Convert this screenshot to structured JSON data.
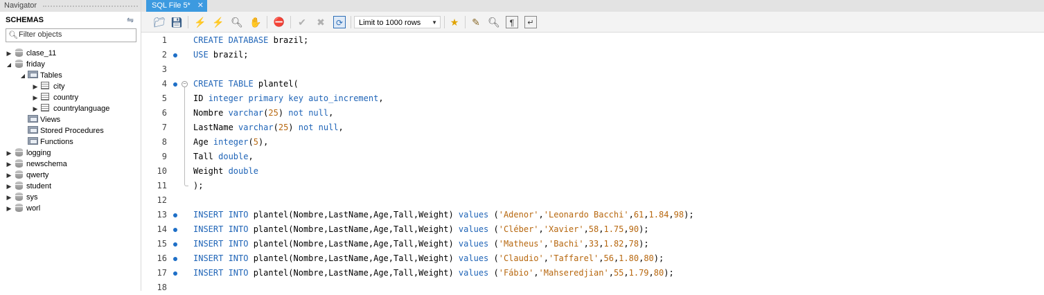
{
  "navigator": {
    "title": "Navigator",
    "schemas_label": "SCHEMAS",
    "filter_placeholder": "Filter objects",
    "tree": [
      {
        "label": "clase_11",
        "level": 0,
        "kind": "db",
        "expanded": false
      },
      {
        "label": "friday",
        "level": 0,
        "kind": "db",
        "expanded": true
      },
      {
        "label": "Tables",
        "level": 1,
        "kind": "folder",
        "expanded": true
      },
      {
        "label": "city",
        "level": 2,
        "kind": "table",
        "expanded": false
      },
      {
        "label": "country",
        "level": 2,
        "kind": "table",
        "expanded": false
      },
      {
        "label": "countrylanguage",
        "level": 2,
        "kind": "table",
        "expanded": false
      },
      {
        "label": "Views",
        "level": 1,
        "kind": "folder",
        "expanded": null
      },
      {
        "label": "Stored Procedures",
        "level": 1,
        "kind": "folder",
        "expanded": null
      },
      {
        "label": "Functions",
        "level": 1,
        "kind": "folder",
        "expanded": null
      },
      {
        "label": "logging",
        "level": 0,
        "kind": "db",
        "expanded": false
      },
      {
        "label": "newschema",
        "level": 0,
        "kind": "db",
        "expanded": false
      },
      {
        "label": "qwerty",
        "level": 0,
        "kind": "db",
        "expanded": false
      },
      {
        "label": "student",
        "level": 0,
        "kind": "db",
        "expanded": false
      },
      {
        "label": "sys",
        "level": 0,
        "kind": "db",
        "expanded": false
      },
      {
        "label": "worl",
        "level": 0,
        "kind": "db",
        "expanded": false
      }
    ]
  },
  "editor_tab": {
    "label": "SQL File 5*",
    "close": "✕"
  },
  "toolbar": {
    "limit_select": "Limit to 1000 rows",
    "icons": [
      "open-file-icon",
      "save-icon",
      "execute-icon",
      "execute-current-icon",
      "explain-icon",
      "stop-icon",
      "toggle-error-icon",
      "commit-icon",
      "rollback-icon",
      "autocommit-icon",
      "add-snippet-icon",
      "beautify-icon",
      "find-icon",
      "invisible-chars-icon",
      "wrap-icon"
    ]
  },
  "editor": {
    "lines": [
      {
        "n": "1",
        "bullet": false,
        "tokens": [
          {
            "t": "CREATE DATABASE",
            "c": "kw"
          },
          {
            "t": " brazil;",
            "c": ""
          }
        ]
      },
      {
        "n": "2",
        "bullet": true,
        "tokens": [
          {
            "t": "USE",
            "c": "kw"
          },
          {
            "t": " brazil;",
            "c": ""
          }
        ]
      },
      {
        "n": "3",
        "bullet": false,
        "tokens": []
      },
      {
        "n": "4",
        "bullet": true,
        "fold": "start",
        "tokens": [
          {
            "t": "CREATE TABLE",
            "c": "kw"
          },
          {
            "t": " plantel(",
            "c": ""
          }
        ]
      },
      {
        "n": "5",
        "bullet": false,
        "tokens": [
          {
            "t": "ID ",
            "c": ""
          },
          {
            "t": "integer primary key auto_increment",
            "c": "kw"
          },
          {
            "t": ",",
            "c": ""
          }
        ]
      },
      {
        "n": "6",
        "bullet": false,
        "tokens": [
          {
            "t": "Nombre ",
            "c": ""
          },
          {
            "t": "varchar",
            "c": "kw"
          },
          {
            "t": "(",
            "c": ""
          },
          {
            "t": "25",
            "c": "num"
          },
          {
            "t": ") ",
            "c": ""
          },
          {
            "t": "not null",
            "c": "kw"
          },
          {
            "t": ",",
            "c": ""
          }
        ]
      },
      {
        "n": "7",
        "bullet": false,
        "tokens": [
          {
            "t": "LastName ",
            "c": ""
          },
          {
            "t": "varchar",
            "c": "kw"
          },
          {
            "t": "(",
            "c": ""
          },
          {
            "t": "25",
            "c": "num"
          },
          {
            "t": ") ",
            "c": ""
          },
          {
            "t": "not null",
            "c": "kw"
          },
          {
            "t": ",",
            "c": ""
          }
        ]
      },
      {
        "n": "8",
        "bullet": false,
        "tokens": [
          {
            "t": "Age ",
            "c": ""
          },
          {
            "t": "integer",
            "c": "kw"
          },
          {
            "t": "(",
            "c": ""
          },
          {
            "t": "5",
            "c": "num"
          },
          {
            "t": "),",
            "c": ""
          }
        ]
      },
      {
        "n": "9",
        "bullet": false,
        "tokens": [
          {
            "t": "Tall ",
            "c": ""
          },
          {
            "t": "double",
            "c": "kw"
          },
          {
            "t": ",",
            "c": ""
          }
        ]
      },
      {
        "n": "10",
        "bullet": false,
        "tokens": [
          {
            "t": "Weight ",
            "c": ""
          },
          {
            "t": "double",
            "c": "kw"
          }
        ]
      },
      {
        "n": "11",
        "bullet": false,
        "fold": "end",
        "tokens": [
          {
            "t": ");",
            "c": ""
          }
        ]
      },
      {
        "n": "12",
        "bullet": false,
        "tokens": []
      },
      {
        "n": "13",
        "bullet": true,
        "tokens": [
          {
            "t": "INSERT INTO",
            "c": "kw"
          },
          {
            "t": " plantel(Nombre,LastName,Age,Tall,Weight) ",
            "c": ""
          },
          {
            "t": "values",
            "c": "kw"
          },
          {
            "t": " (",
            "c": ""
          },
          {
            "t": "'Adenor'",
            "c": "str"
          },
          {
            "t": ",",
            "c": ""
          },
          {
            "t": "'Leonardo Bacchi'",
            "c": "str"
          },
          {
            "t": ",",
            "c": ""
          },
          {
            "t": "61",
            "c": "num"
          },
          {
            "t": ",",
            "c": ""
          },
          {
            "t": "1.84",
            "c": "num"
          },
          {
            "t": ",",
            "c": ""
          },
          {
            "t": "98",
            "c": "num"
          },
          {
            "t": ");",
            "c": ""
          }
        ]
      },
      {
        "n": "14",
        "bullet": true,
        "tokens": [
          {
            "t": "INSERT INTO",
            "c": "kw"
          },
          {
            "t": " plantel(Nombre,LastName,Age,Tall,Weight) ",
            "c": ""
          },
          {
            "t": "values",
            "c": "kw"
          },
          {
            "t": " (",
            "c": ""
          },
          {
            "t": "'Cléber'",
            "c": "str"
          },
          {
            "t": ",",
            "c": ""
          },
          {
            "t": "'Xavier'",
            "c": "str"
          },
          {
            "t": ",",
            "c": ""
          },
          {
            "t": "58",
            "c": "num"
          },
          {
            "t": ",",
            "c": ""
          },
          {
            "t": "1.75",
            "c": "num"
          },
          {
            "t": ",",
            "c": ""
          },
          {
            "t": "90",
            "c": "num"
          },
          {
            "t": ");",
            "c": ""
          }
        ]
      },
      {
        "n": "15",
        "bullet": true,
        "tokens": [
          {
            "t": "INSERT INTO",
            "c": "kw"
          },
          {
            "t": " plantel(Nombre,LastName,Age,Tall,Weight) ",
            "c": ""
          },
          {
            "t": "values",
            "c": "kw"
          },
          {
            "t": " (",
            "c": ""
          },
          {
            "t": "'Matheus'",
            "c": "str"
          },
          {
            "t": ",",
            "c": ""
          },
          {
            "t": "'Bachi'",
            "c": "str"
          },
          {
            "t": ",",
            "c": ""
          },
          {
            "t": "33",
            "c": "num"
          },
          {
            "t": ",",
            "c": ""
          },
          {
            "t": "1.82",
            "c": "num"
          },
          {
            "t": ",",
            "c": ""
          },
          {
            "t": "78",
            "c": "num"
          },
          {
            "t": ");",
            "c": ""
          }
        ]
      },
      {
        "n": "16",
        "bullet": true,
        "tokens": [
          {
            "t": "INSERT INTO",
            "c": "kw"
          },
          {
            "t": " plantel(Nombre,LastName,Age,Tall,Weight) ",
            "c": ""
          },
          {
            "t": "values",
            "c": "kw"
          },
          {
            "t": " (",
            "c": ""
          },
          {
            "t": "'Claudio'",
            "c": "str"
          },
          {
            "t": ",",
            "c": ""
          },
          {
            "t": "'Taffarel'",
            "c": "str"
          },
          {
            "t": ",",
            "c": ""
          },
          {
            "t": "56",
            "c": "num"
          },
          {
            "t": ",",
            "c": ""
          },
          {
            "t": "1.80",
            "c": "num"
          },
          {
            "t": ",",
            "c": ""
          },
          {
            "t": "80",
            "c": "num"
          },
          {
            "t": ");",
            "c": ""
          }
        ]
      },
      {
        "n": "17",
        "bullet": true,
        "tokens": [
          {
            "t": "INSERT INTO",
            "c": "kw"
          },
          {
            "t": " plantel(Nombre,LastName,Age,Tall,Weight) ",
            "c": ""
          },
          {
            "t": "values",
            "c": "kw"
          },
          {
            "t": " (",
            "c": ""
          },
          {
            "t": "'Fábio'",
            "c": "str"
          },
          {
            "t": ",",
            "c": ""
          },
          {
            "t": "'Mahseredjian'",
            "c": "str"
          },
          {
            "t": ",",
            "c": ""
          },
          {
            "t": "55",
            "c": "num"
          },
          {
            "t": ",",
            "c": ""
          },
          {
            "t": "1.79",
            "c": "num"
          },
          {
            "t": ",",
            "c": ""
          },
          {
            "t": "80",
            "c": "num"
          },
          {
            "t": ");",
            "c": ""
          }
        ]
      },
      {
        "n": "18",
        "bullet": false,
        "tokens": []
      }
    ]
  },
  "colors": {
    "keyword": "#1f64b7",
    "literal": "#b7670e",
    "tab_active": "#3c9ae0",
    "bullet": "#1e6fc7"
  }
}
